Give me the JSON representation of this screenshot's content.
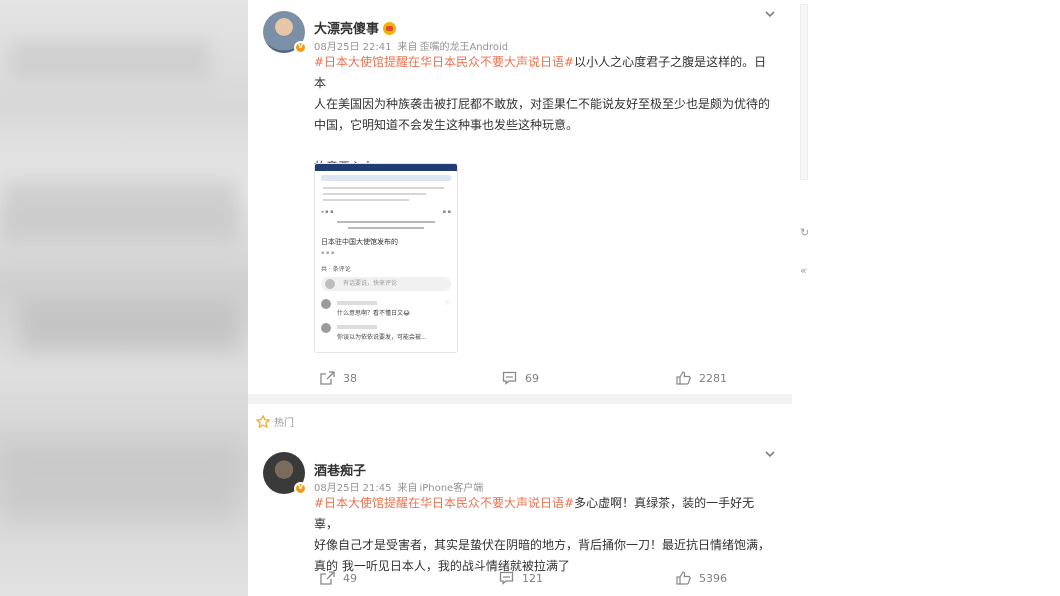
{
  "feed": [
    {
      "user": "大漂亮傻事",
      "time": "08月25日 22:41",
      "via": "来自",
      "client": "歪嘴的龙王Android",
      "topic": "#日本大使馆提醒在华日本民众不要大声说日语#",
      "lines": [
        "以小人之心度君子之腹是这样的。日本",
        "人在美国因为种族袭击被打屁都不敢放，对歪果仁不能说友好至极至少也是颇为优待的",
        "中国，它明知道不会发生这种事也发些这种玩意。",
        "故意恶心人。"
      ],
      "thumb": {
        "label": "日本驻中国大使馆发布的",
        "comments_title": "共 · 条评论",
        "input_hint": "有话要说，快来评论",
        "reply_1": "什么意思啊？看不懂日文😂",
        "reply_2": "你误以为依依说要发，可能会被..."
      },
      "stats": {
        "reposts": "38",
        "comments": "69",
        "likes": "2281"
      }
    },
    {
      "badge": "热门",
      "user": "酒巷痴子",
      "time": "08月25日 21:45",
      "via": "来自",
      "client": "iPhone客户端",
      "topic": "#日本大使馆提醒在华日本民众不要大声说日语#",
      "lines": [
        "多心虚啊！真绿茶，装的一手好无辜，",
        "好像自己才是受害者，其实是蛰伏在阴暗的地方，背后捅你一刀！最近抗日情绪饱满，",
        "真的 我一听见日本人，我的战斗情绪就被拉满了"
      ],
      "stats": {
        "reposts": "49",
        "comments": "121",
        "likes": "5396"
      }
    }
  ],
  "theme": {
    "topic_color": "#eb7350",
    "meta_color": "#939393",
    "icon_color": "#808080"
  }
}
